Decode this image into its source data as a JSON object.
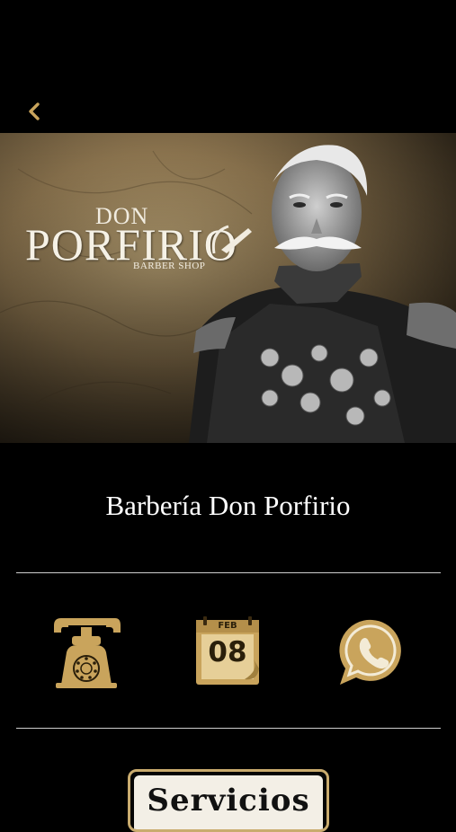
{
  "header": {
    "back_icon": "chevron-left-icon",
    "accent": "#c9a45c"
  },
  "hero": {
    "logo_top": "DON",
    "logo_main": "PORFIRIO",
    "logo_sub": "BARBER SHOP",
    "logo_icon": "razor-icon"
  },
  "business": {
    "name": "Barbería Don Porfirio"
  },
  "actions": [
    {
      "name": "phone",
      "icon": "vintage-phone-icon"
    },
    {
      "name": "calendar",
      "icon": "calendar-icon",
      "month": "FEB",
      "day": "08"
    },
    {
      "name": "whatsapp",
      "icon": "whatsapp-icon"
    }
  ],
  "services": {
    "label": "Servicios"
  },
  "colors": {
    "gold": "#c9a45c",
    "background": "#000000",
    "text": "#ffffff"
  }
}
